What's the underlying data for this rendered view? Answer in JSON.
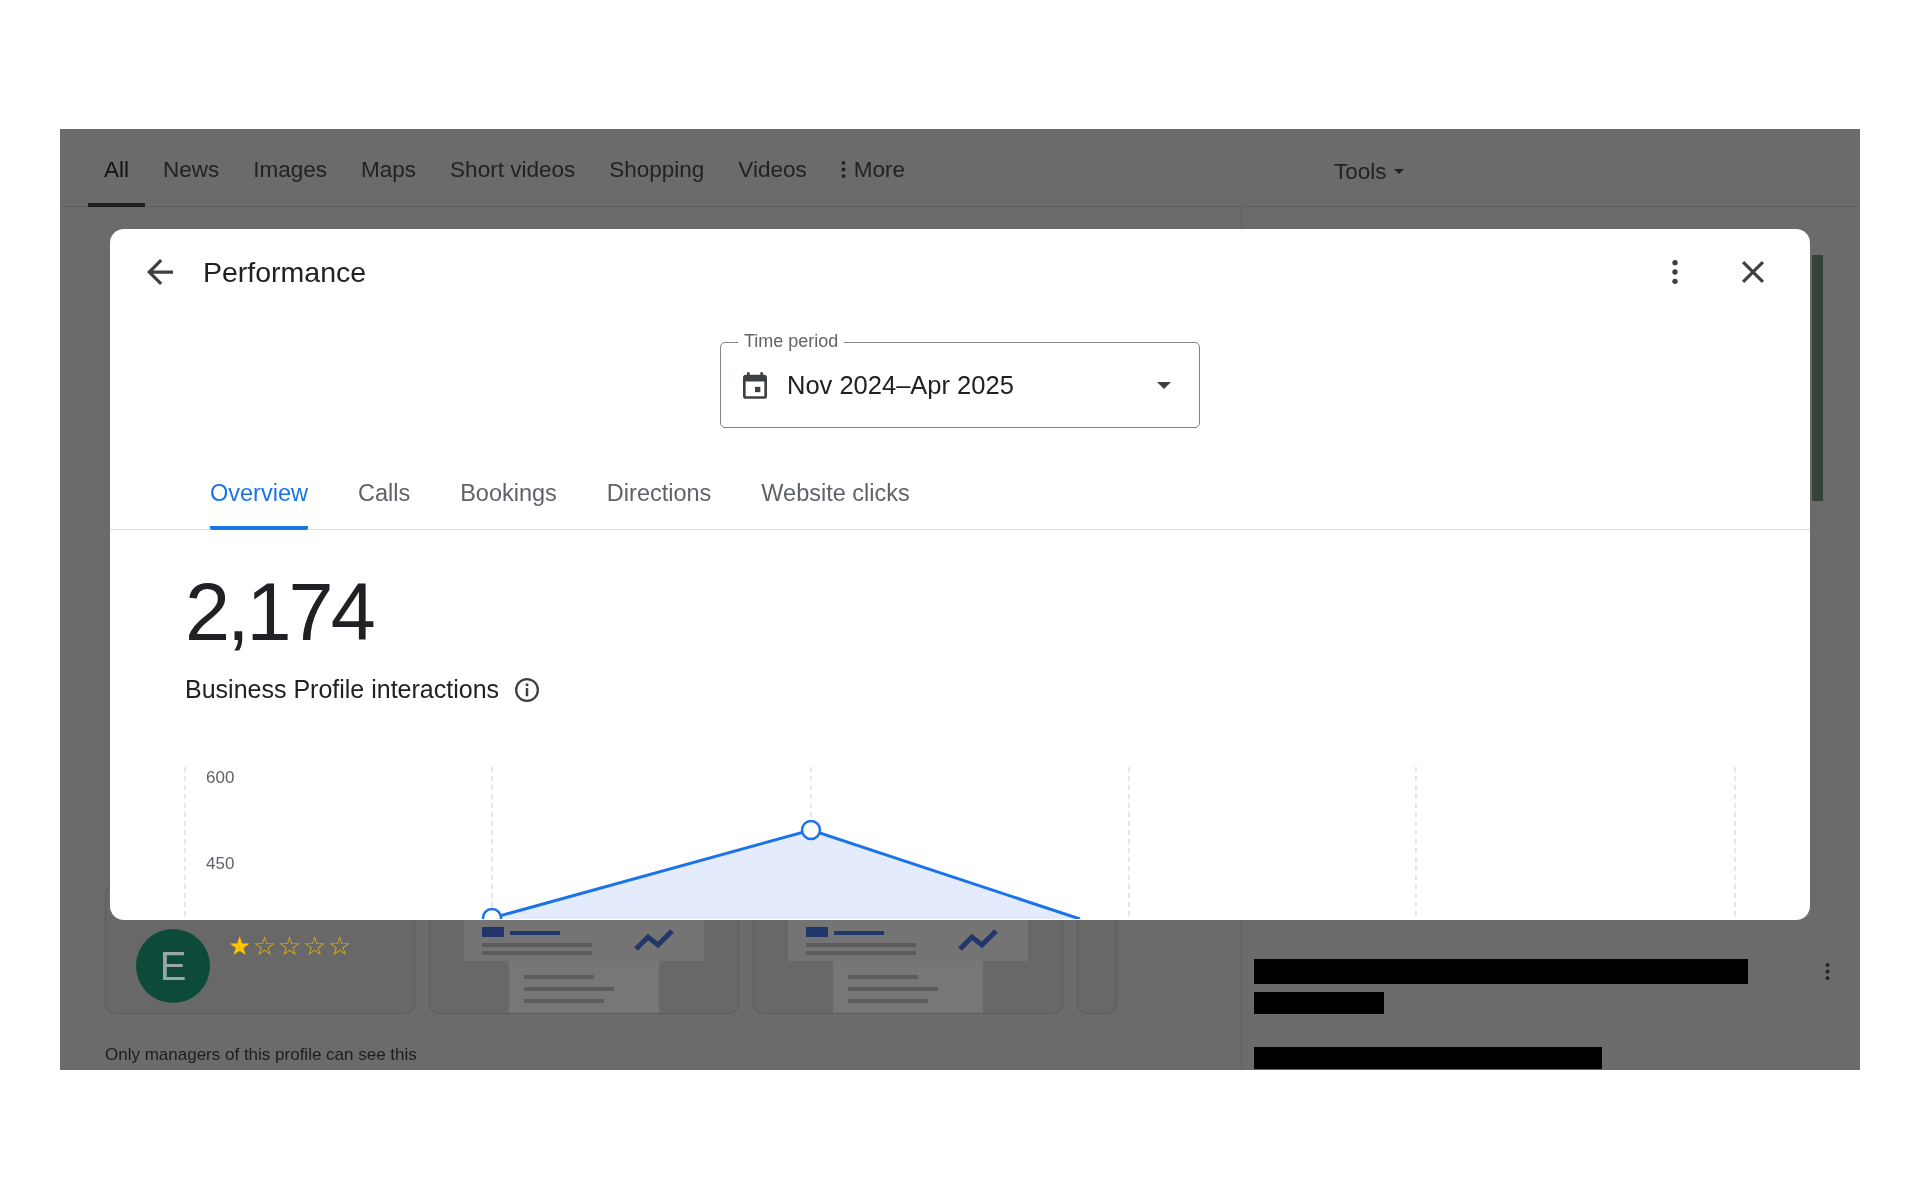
{
  "search_tabs": [
    {
      "label": "All",
      "selected": true,
      "kind": "plain"
    },
    {
      "label": "News",
      "selected": false,
      "kind": "plain"
    },
    {
      "label": "Images",
      "selected": false,
      "kind": "plain"
    },
    {
      "label": "Maps",
      "selected": false,
      "kind": "plain"
    },
    {
      "label": "Short videos",
      "selected": false,
      "kind": "plain"
    },
    {
      "label": "Shopping",
      "selected": false,
      "kind": "plain"
    },
    {
      "label": "Videos",
      "selected": false,
      "kind": "plain"
    },
    {
      "label": "More",
      "selected": false,
      "kind": "menu"
    }
  ],
  "tools": {
    "label": "Tools"
  },
  "background": {
    "cards": [
      {
        "kind": "profile",
        "avatar_letter": "E",
        "stars": 1
      },
      {
        "kind": "illustration"
      },
      {
        "kind": "illustration"
      },
      {
        "kind": "partial"
      }
    ],
    "note": "Only managers of this profile can see this"
  },
  "dialog": {
    "title": "Performance",
    "time_period": {
      "label": "Time period",
      "value": "Nov 2024–Apr 2025"
    },
    "tabs": [
      {
        "label": "Overview",
        "selected": true
      },
      {
        "label": "Calls",
        "selected": false
      },
      {
        "label": "Bookings",
        "selected": false
      },
      {
        "label": "Directions",
        "selected": false
      },
      {
        "label": "Website clicks",
        "selected": false
      }
    ],
    "total": "2,174",
    "metric_label": "Business Profile interactions",
    "chart": {
      "y_labels": [
        "600",
        "450"
      ]
    }
  }
}
